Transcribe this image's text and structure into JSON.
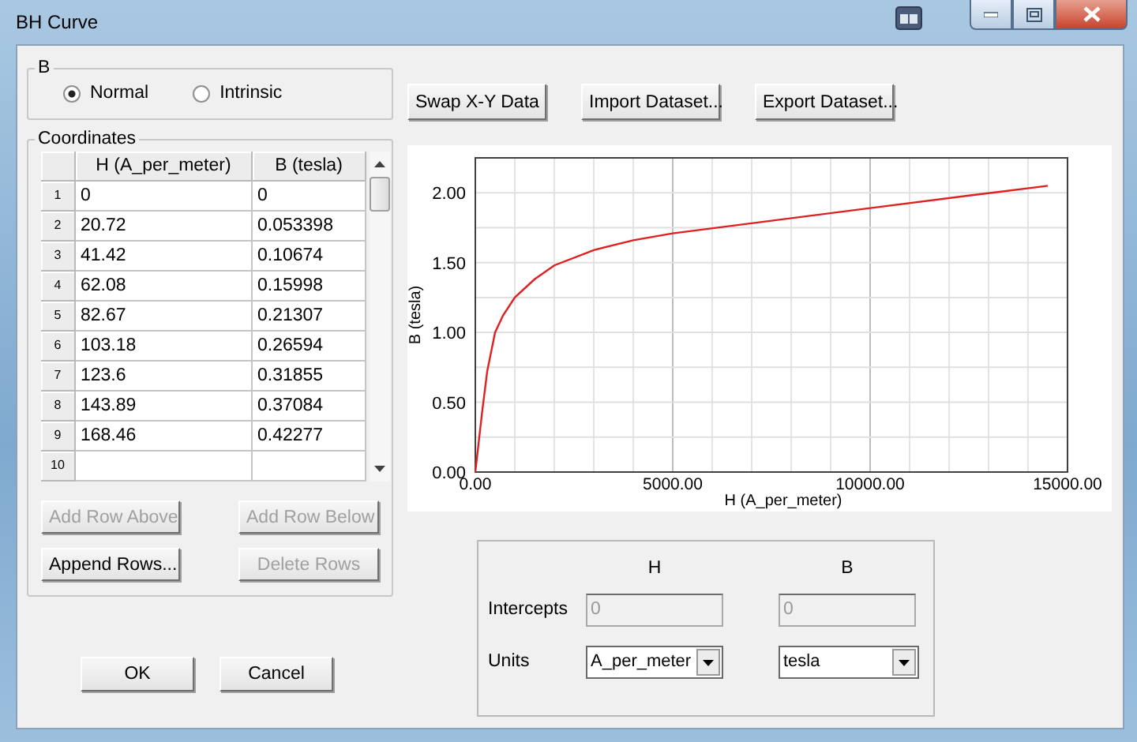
{
  "window": {
    "title": "BH Curve"
  },
  "b_group": {
    "label": "B",
    "options": [
      {
        "label": "Normal",
        "selected": true
      },
      {
        "label": "Intrinsic",
        "selected": false
      }
    ]
  },
  "toolbar_buttons": [
    "Swap X-Y Data",
    "Import Dataset...",
    "Export Dataset..."
  ],
  "coordinates": {
    "label": "Coordinates",
    "columns": [
      "H (A_per_meter)",
      "B (tesla)"
    ],
    "rows": [
      {
        "number": "1",
        "h": "0",
        "b": "0"
      },
      {
        "number": "2",
        "h": "20.72",
        "b": "0.053398"
      },
      {
        "number": "3",
        "h": "41.42",
        "b": "0.10674"
      },
      {
        "number": "4",
        "h": "62.08",
        "b": "0.15998"
      },
      {
        "number": "5",
        "h": "82.67",
        "b": "0.21307"
      },
      {
        "number": "6",
        "h": "103.18",
        "b": "0.26594"
      },
      {
        "number": "7",
        "h": "123.6",
        "b": "0.31855"
      },
      {
        "number": "8",
        "h": "143.89",
        "b": "0.37084"
      },
      {
        "number": "9",
        "h": "168.46",
        "b": "0.42277"
      },
      {
        "number": "10"
      }
    ],
    "buttons": [
      {
        "label": "Add Row Above",
        "disabled": true
      },
      {
        "label": "Add Row Below",
        "disabled": true
      },
      {
        "label": "Append Rows...",
        "disabled": false
      },
      {
        "label": "Delete Rows",
        "disabled": true
      }
    ]
  },
  "chart": {
    "chart_data": {
      "type": "line",
      "xlabel": "H (A_per_meter)",
      "ylabel": "B (tesla)",
      "grid": true,
      "x": [
        0,
        168,
        300,
        500,
        700,
        1000,
        1500,
        2000,
        3000,
        4000,
        5000,
        7500,
        10000,
        12500,
        14500
      ],
      "series": [
        {
          "color": "#e02020",
          "values": [
            0,
            0.42,
            0.72,
            1.0,
            1.12,
            1.25,
            1.38,
            1.48,
            1.59,
            1.66,
            1.71,
            1.8,
            1.89,
            1.98,
            2.05
          ]
        }
      ],
      "xlim": [
        0,
        15000
      ],
      "ylim": [
        0,
        2.25
      ],
      "xticks": [
        {
          "value": 0,
          "label": "0.00"
        },
        {
          "value": 5000,
          "label": "5000.00"
        },
        {
          "value": 10000,
          "label": "10000.00"
        },
        {
          "value": 15000,
          "label": "15000.00"
        }
      ],
      "yticks": [
        {
          "value": 0,
          "label": "0.00"
        },
        {
          "value": 0.5,
          "label": "0.50"
        },
        {
          "value": 1,
          "label": "1.00"
        },
        {
          "value": 1.5,
          "label": "1.50"
        },
        {
          "value": 2,
          "label": "2.00"
        }
      ]
    }
  },
  "axes_group": {
    "columns": [
      "H",
      "B"
    ],
    "intercepts_label": "Intercepts",
    "intercepts": [
      {
        "value": "0",
        "disabled": true
      },
      {
        "value": "0",
        "disabled": true
      }
    ],
    "units_label": "Units",
    "units": [
      "A_per_meter",
      "tesla"
    ]
  },
  "dialog_buttons": [
    "OK",
    "Cancel"
  ]
}
